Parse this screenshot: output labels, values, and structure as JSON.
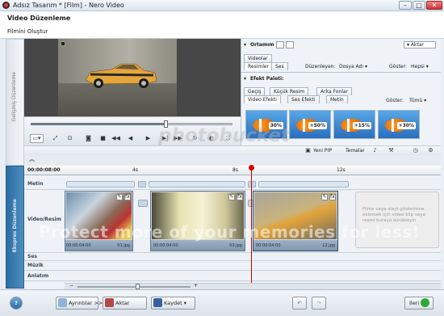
{
  "window": {
    "title": "Adsız Tasarım * [Film] - Nero Video",
    "minimize": "–",
    "maximize": "□",
    "close": "✕"
  },
  "header": {
    "title": "Video Düzenleme",
    "subtitle": "Filmini Oluştur"
  },
  "side_tabs": {
    "top": "Gelişmiş Düzenleme",
    "bottom": "Ekspres Düzenleme"
  },
  "media_panel": {
    "title": "Ortamım",
    "export_label": "Aktar",
    "tabs": [
      "Videolar",
      "Resimler",
      "Ses"
    ],
    "sort_label": "Düzenleyen:",
    "sort_value": "Dosya Adı",
    "show_label": "Göster:",
    "show_value": "Hepsi"
  },
  "effects_panel": {
    "title": "Efekt Paleti:",
    "tabs_row1": [
      "Geçiş",
      "Küçük Resim",
      "Arka Fonlar"
    ],
    "tabs_row2": [
      "Video Efekti",
      "Ses Efekti",
      "Metin"
    ],
    "show_label": "Göster:",
    "show_value": "Tümü",
    "thumbs": [
      "30%",
      "+50%",
      "+15%",
      "+30%"
    ]
  },
  "bottom_toolbar": {
    "pip": "Yeni PIP",
    "themes": "Temalar"
  },
  "timeline": {
    "start_time": "00:00:08:00",
    "ticks": [
      "4s",
      "8s",
      "12s"
    ],
    "tracks": [
      "Metin",
      "Video/Resim",
      "Ses",
      "Müzik",
      "Anlatım"
    ],
    "clips": [
      {
        "start": "00:00:04:00",
        "name": "01.jpg"
      },
      {
        "start": "00:00:04:00",
        "name": "03.jpg"
      },
      {
        "start": "00:00:04:00",
        "name": "12.jpg"
      }
    ],
    "drop_hint": "Filme veya slayt gösterisine eklemek için video klip veya resmi buraya sürükleyin"
  },
  "footer": {
    "help": "?",
    "options": "Ayrıntılar >>",
    "export": "Aktar",
    "save": "Kaydet",
    "next": "İleri"
  },
  "watermark": {
    "line1": "Protect more of your memories for less!",
    "brand": "photobucket"
  },
  "colors": {
    "accent": "#2c6ea3",
    "playhead": "#c20000",
    "next_button": "#2fa83a"
  }
}
